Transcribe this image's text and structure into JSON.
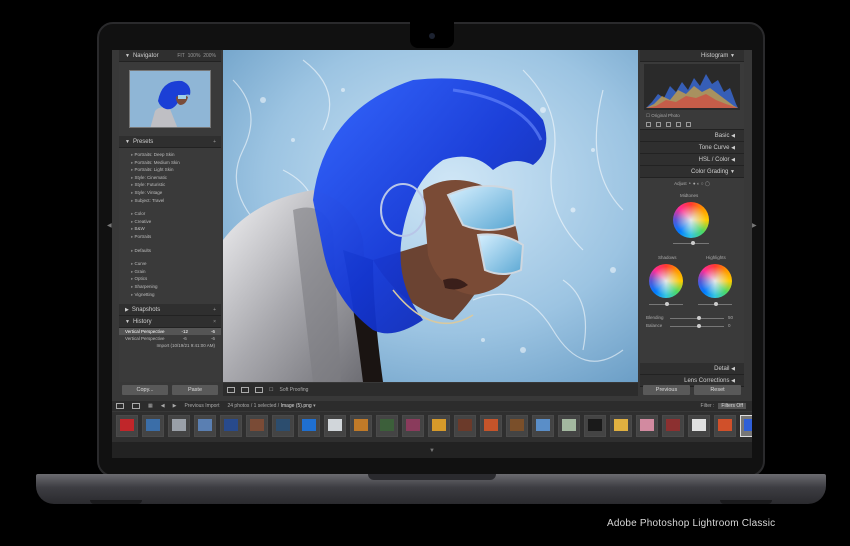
{
  "caption": "Adobe Photoshop Lightroom Classic",
  "left_panel": {
    "navigator": {
      "title": "Navigator",
      "zoom_options": [
        "FIT",
        "100%",
        "200%"
      ]
    },
    "presets": {
      "title": "Presets",
      "group1": [
        "Portraits: Deep Skin",
        "Portraits: Medium Skin",
        "Portraits: Light Skin",
        "Style: Cinematic",
        "Style: Futuristic",
        "Style: Vintage",
        "Subject: Travel"
      ],
      "group2": [
        "Color",
        "Creative",
        "B&W",
        "Portraits"
      ],
      "group3": [
        "Defaults"
      ],
      "group4": [
        "Curve",
        "Grain",
        "Optics",
        "Sharpening",
        "Vignetting"
      ]
    },
    "snapshots": {
      "title": "Snapshots"
    },
    "history": {
      "title": "History",
      "rows": [
        {
          "label": "Vertical Perspective",
          "value": "-12",
          "delta": "-6",
          "selected": true
        },
        {
          "label": "Vertical Perspective",
          "value": "-6",
          "delta": "-6",
          "selected": false
        },
        {
          "label": "Import (10/19/21 9:41:00 AM)",
          "value": "",
          "delta": "",
          "selected": false
        }
      ]
    },
    "copy_label": "Copy...",
    "paste_label": "Paste"
  },
  "toolbar": {
    "soft_proofing": "Soft Proofing"
  },
  "right_panel": {
    "histogram_title": "Histogram",
    "original_photo": "Original Photo",
    "sections": {
      "basic": "Basic",
      "tone_curve": "Tone Curve",
      "hsl": "HSL / Color",
      "color_grading": "Color Grading",
      "detail": "Detail",
      "lens_corrections": "Lens Corrections"
    },
    "cg_adjust": "Adjust",
    "midtones": "Midtones",
    "shadows": "Shadows",
    "highlights": "Highlights",
    "blending": "Blending",
    "blending_value": "50",
    "balance": "Balance",
    "balance_value": "0",
    "previous_label": "Previous",
    "reset_label": "Reset"
  },
  "filmstrip_bar": {
    "source": "Previous Import",
    "count": "24 photos / 1 selected /",
    "filename": "Image (5).png",
    "filter_label": "Filter :",
    "filters_off": "Filters Off"
  },
  "colors": {
    "panel": "#3a3a3a",
    "header": "#2f2f2f",
    "accent_blue": "#1b4ff0"
  }
}
